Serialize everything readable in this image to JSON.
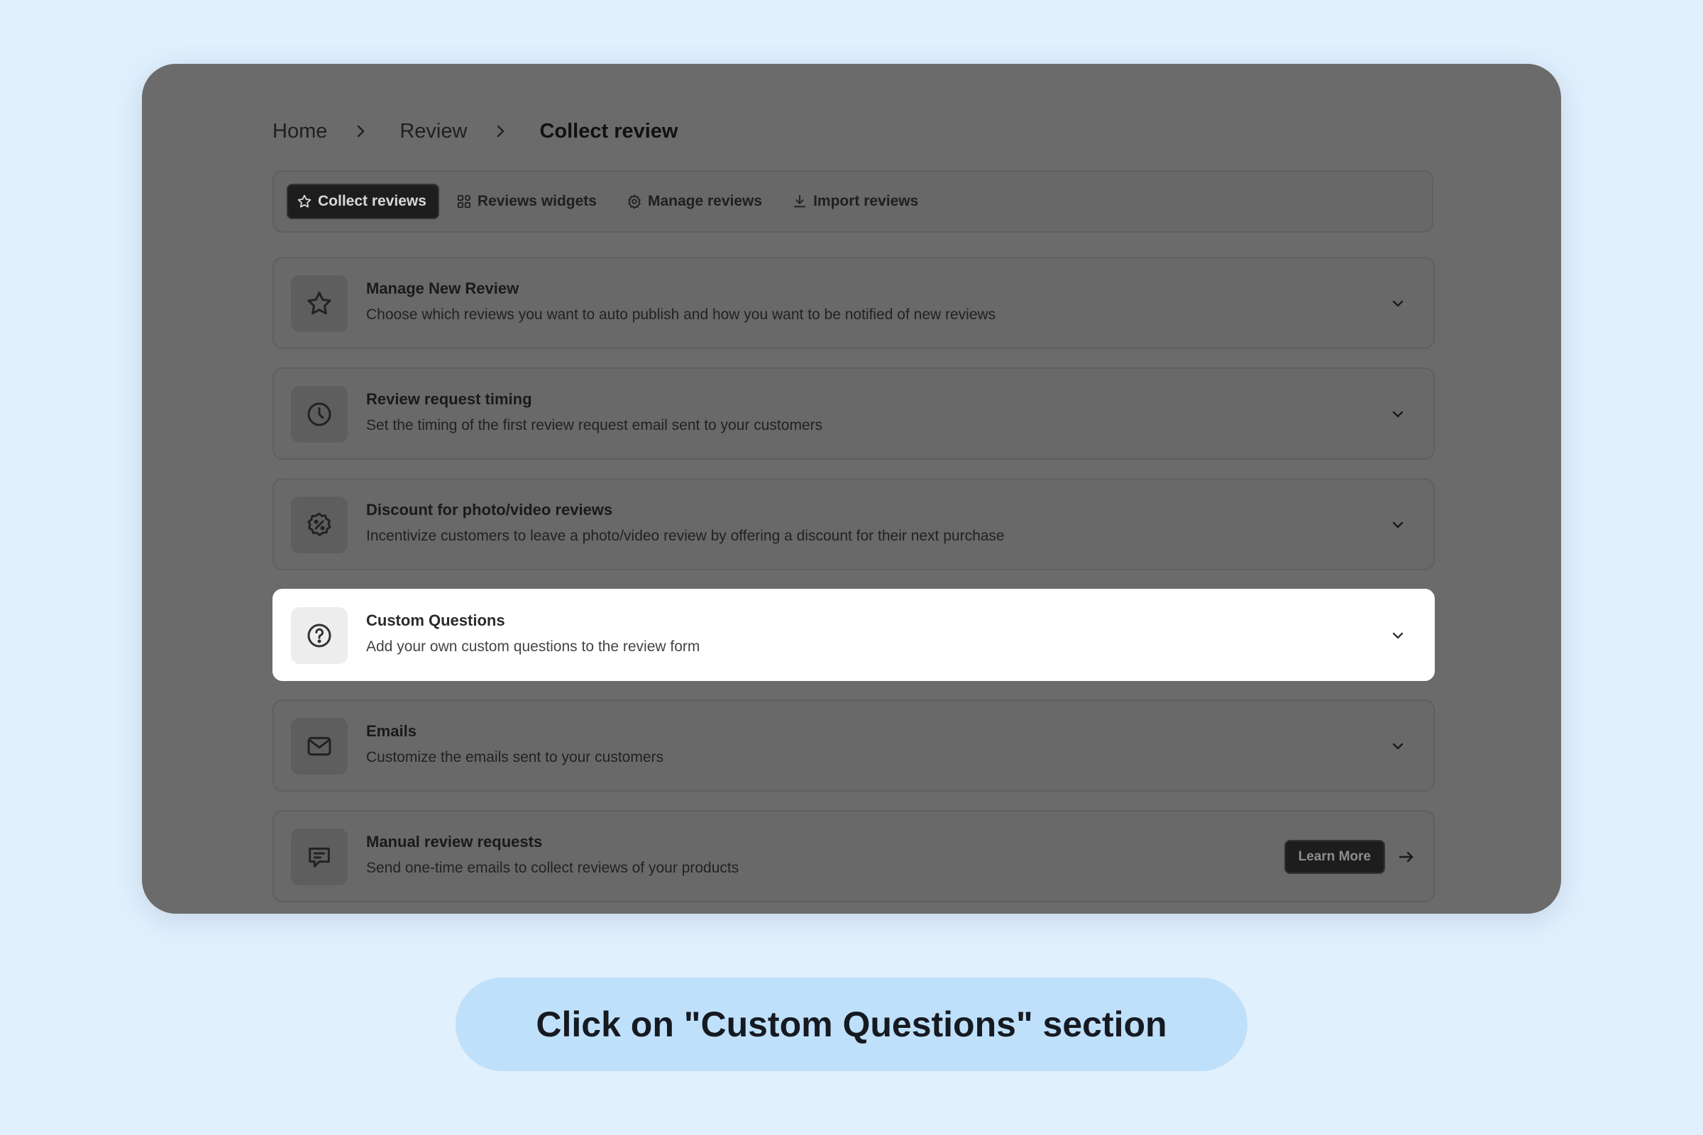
{
  "breadcrumb": {
    "items": [
      "Home",
      "Review",
      "Collect review"
    ]
  },
  "tabs": [
    {
      "label": "Collect reviews",
      "icon": "star-icon",
      "active": true
    },
    {
      "label": "Reviews widgets",
      "icon": "widgets-icon",
      "active": false
    },
    {
      "label": "Manage reviews",
      "icon": "gear-icon",
      "active": false
    },
    {
      "label": "Import reviews",
      "icon": "download-icon",
      "active": false
    }
  ],
  "sections": [
    {
      "title": "Manage New Review",
      "description": "Choose which reviews you want to auto publish and how you want to be notified of new reviews",
      "icon": "star-icon"
    },
    {
      "title": "Review request timing",
      "description": "Set the timing of the first review request email sent to your customers",
      "icon": "clock-icon"
    },
    {
      "title": "Discount for photo/video reviews",
      "description": "Incentivize customers to leave a photo/video review by offering a discount for their next purchase",
      "icon": "discount-badge-icon"
    },
    {
      "title": "Custom Questions",
      "description": "Add your own custom questions to the review form",
      "icon": "question-circle-icon",
      "highlighted": true
    },
    {
      "title": "Emails",
      "description": "Customize the emails sent to your customers",
      "icon": "envelope-icon"
    },
    {
      "title": "Manual review requests",
      "description": "Send one-time emails to collect reviews of your products",
      "icon": "chat-bubble-icon",
      "action_label": "Learn More"
    }
  ],
  "caption": "Click on \"Custom Questions\" section",
  "colors": {
    "background": "#e1f0fd",
    "overlay": "#6b6b6b",
    "highlight": "#ffffff",
    "caption_bg": "#bfe0fb",
    "active_tab": "#1d1d1d"
  }
}
